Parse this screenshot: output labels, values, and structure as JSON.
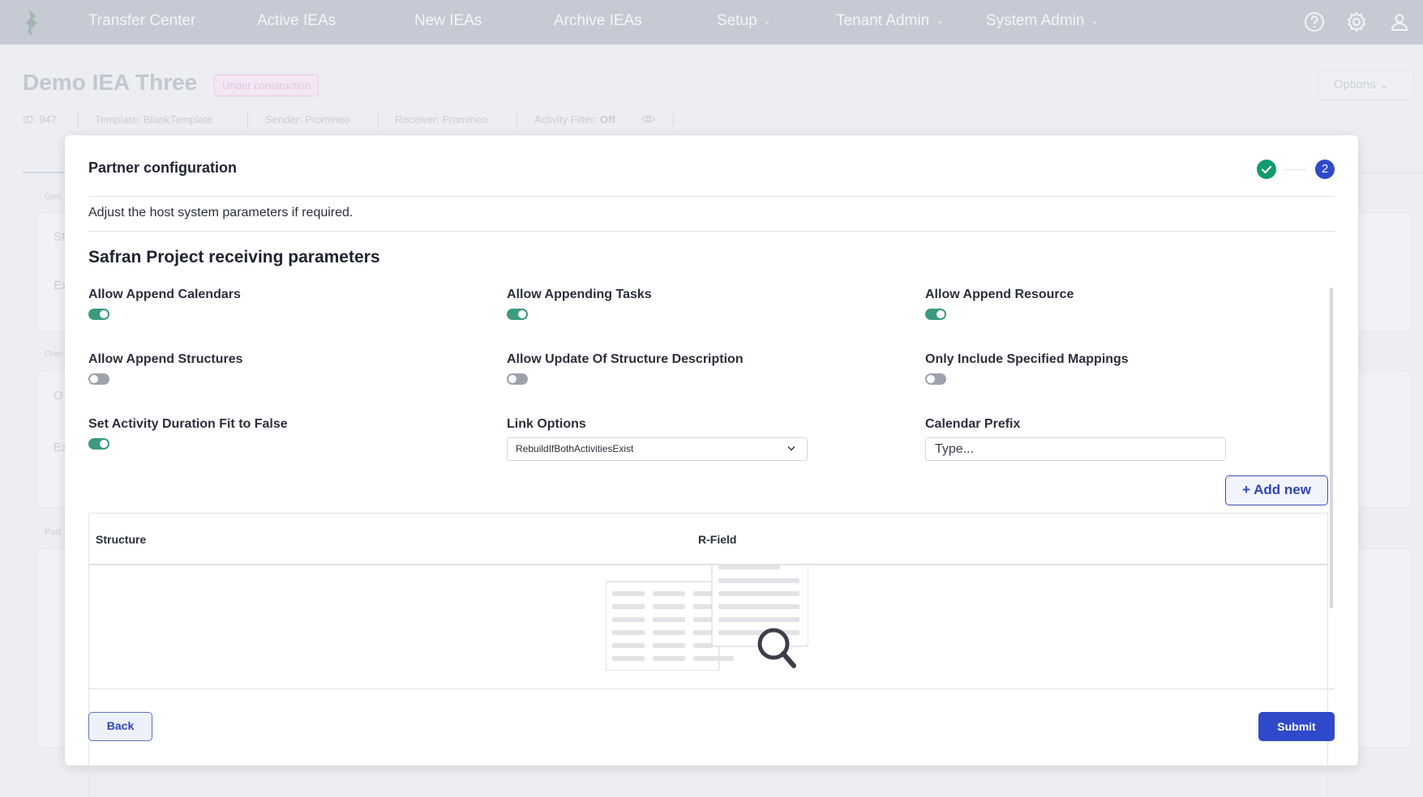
{
  "nav": {
    "items": [
      {
        "label": "Transfer Center"
      },
      {
        "label": "Active IEAs"
      },
      {
        "label": "New IEAs"
      },
      {
        "label": "Archive IEAs"
      },
      {
        "label": "Setup"
      },
      {
        "label": "Tenant Admin"
      },
      {
        "label": "System Admin"
      }
    ],
    "icons": [
      "help-icon",
      "settings-gear-icon",
      "user-profile-icon"
    ]
  },
  "background_page": {
    "title": "Demo IEA Three",
    "status_badge": "Under construction",
    "options_label": "Options",
    "meta": {
      "id": "ID: 947",
      "template": "Template: BlankTemplate",
      "sender": "Sender: Promineo",
      "receiver": "Receiver: Promineo",
      "activity_filter_label": "Activity Filter:",
      "activity_filter_value": "Off"
    },
    "section_labels": [
      "Gen",
      "Own",
      "Part"
    ],
    "card_letters": [
      "St",
      "Ex",
      "O",
      "Ex"
    ]
  },
  "modal": {
    "title": "Partner configuration",
    "steps": {
      "completed": 1,
      "current_label": "2"
    },
    "subtitle": "Adjust the host system parameters if required.",
    "section_title": "Safran Project receiving parameters",
    "fields": {
      "allow_append_calendars": {
        "label": "Allow Append Calendars",
        "enabled": true
      },
      "allow_appending_tasks": {
        "label": "Allow Appending Tasks",
        "enabled": true
      },
      "allow_append_resource": {
        "label": "Allow Append Resource",
        "enabled": true
      },
      "allow_append_structures": {
        "label": "Allow Append Structures",
        "enabled": false
      },
      "allow_update_structure_description": {
        "label": "Allow Update Of Structure Description",
        "enabled": false
      },
      "only_include_specified_mappings": {
        "label": "Only Include Specified Mappings",
        "enabled": false
      },
      "set_activity_duration_fit_false": {
        "label": "Set Activity Duration Fit to False",
        "enabled": true
      },
      "link_options": {
        "label": "Link Options",
        "value": "RebuildIfBothActivitiesExist"
      },
      "calendar_prefix": {
        "label": "Calendar Prefix",
        "placeholder": "Type..."
      }
    },
    "add_new_label": "+ Add new",
    "table": {
      "columns": [
        "Structure",
        "R-Field"
      ]
    },
    "back_label": "Back",
    "submit_label": "Submit"
  },
  "colors": {
    "nav_bg": "#c6cad4",
    "primary": "#2e49c9",
    "toggle_on": "#3c9a7e",
    "toggle_off": "#9ea3ab",
    "step_done": "#129a6f"
  }
}
